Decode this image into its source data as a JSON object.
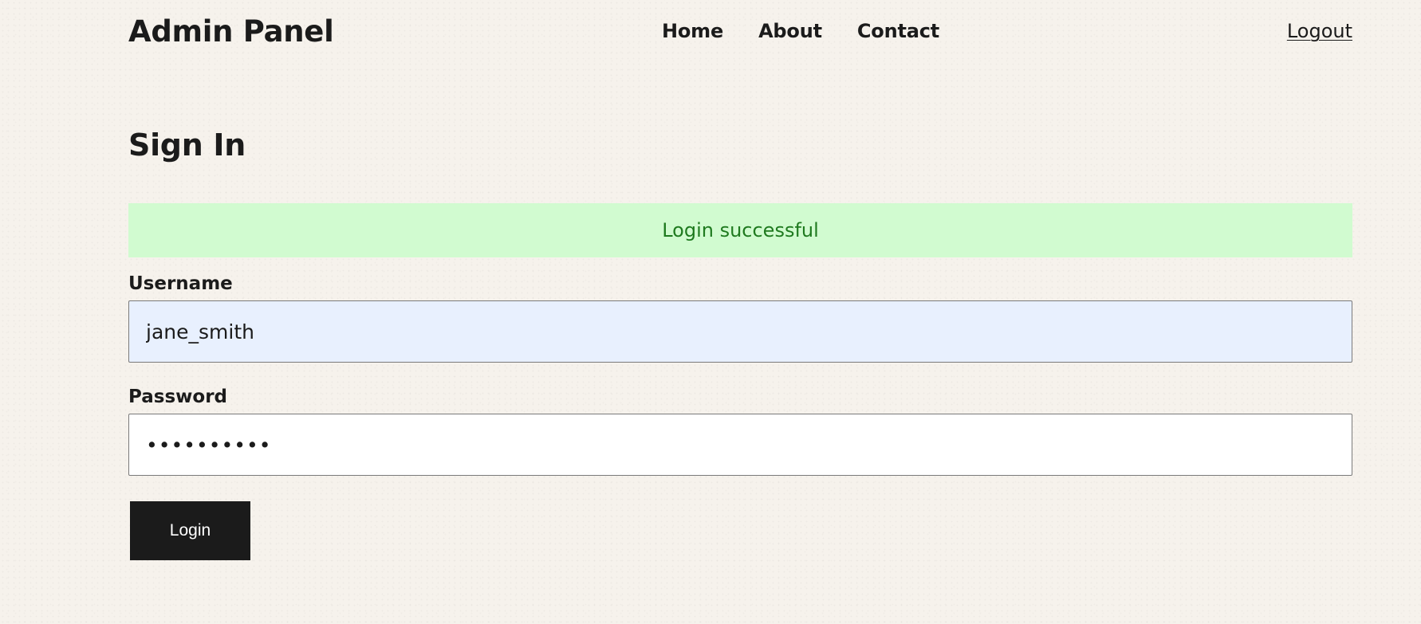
{
  "header": {
    "brand": "Admin Panel",
    "nav": [
      {
        "label": "Home"
      },
      {
        "label": "About"
      },
      {
        "label": "Contact"
      }
    ],
    "logout_label": "Logout"
  },
  "page": {
    "title": "Sign In",
    "alert": {
      "text": "Login successful",
      "bg_color": "#d1fbd0",
      "text_color": "#1f7a1f"
    }
  },
  "form": {
    "username": {
      "label": "Username",
      "value": "jane_smith"
    },
    "password": {
      "label": "Password",
      "value": "••••••••••"
    },
    "submit_label": "Login"
  },
  "colors": {
    "background": "#f6f2ec",
    "text": "#1b1b1b",
    "button": "#1b1b1b",
    "autofill": "#e8f0fe"
  }
}
